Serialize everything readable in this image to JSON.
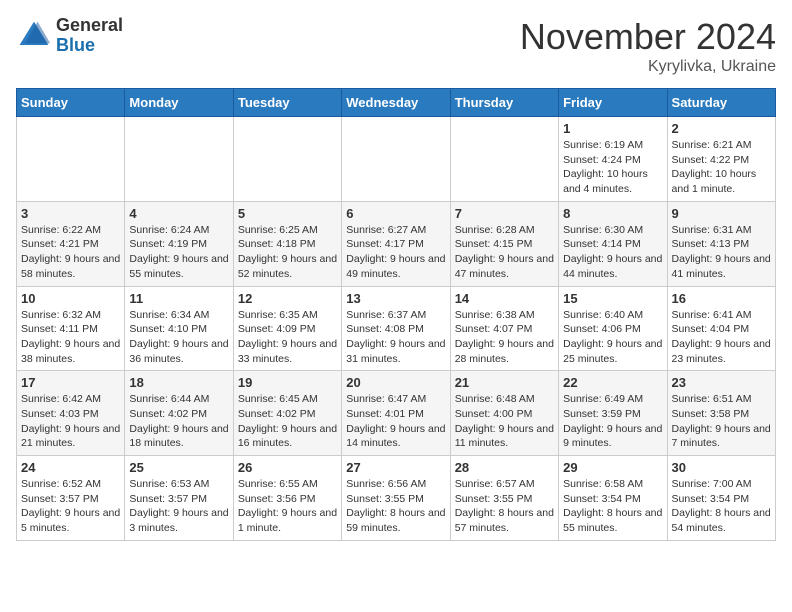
{
  "header": {
    "logo_general": "General",
    "logo_blue": "Blue",
    "month_title": "November 2024",
    "location": "Kyrylivka, Ukraine"
  },
  "weekdays": [
    "Sunday",
    "Monday",
    "Tuesday",
    "Wednesday",
    "Thursday",
    "Friday",
    "Saturday"
  ],
  "weeks": [
    [
      {
        "day": "",
        "info": ""
      },
      {
        "day": "",
        "info": ""
      },
      {
        "day": "",
        "info": ""
      },
      {
        "day": "",
        "info": ""
      },
      {
        "day": "",
        "info": ""
      },
      {
        "day": "1",
        "info": "Sunrise: 6:19 AM\nSunset: 4:24 PM\nDaylight: 10 hours\nand 4 minutes."
      },
      {
        "day": "2",
        "info": "Sunrise: 6:21 AM\nSunset: 4:22 PM\nDaylight: 10 hours\nand 1 minute."
      }
    ],
    [
      {
        "day": "3",
        "info": "Sunrise: 6:22 AM\nSunset: 4:21 PM\nDaylight: 9 hours\nand 58 minutes."
      },
      {
        "day": "4",
        "info": "Sunrise: 6:24 AM\nSunset: 4:19 PM\nDaylight: 9 hours\nand 55 minutes."
      },
      {
        "day": "5",
        "info": "Sunrise: 6:25 AM\nSunset: 4:18 PM\nDaylight: 9 hours\nand 52 minutes."
      },
      {
        "day": "6",
        "info": "Sunrise: 6:27 AM\nSunset: 4:17 PM\nDaylight: 9 hours\nand 49 minutes."
      },
      {
        "day": "7",
        "info": "Sunrise: 6:28 AM\nSunset: 4:15 PM\nDaylight: 9 hours\nand 47 minutes."
      },
      {
        "day": "8",
        "info": "Sunrise: 6:30 AM\nSunset: 4:14 PM\nDaylight: 9 hours\nand 44 minutes."
      },
      {
        "day": "9",
        "info": "Sunrise: 6:31 AM\nSunset: 4:13 PM\nDaylight: 9 hours\nand 41 minutes."
      }
    ],
    [
      {
        "day": "10",
        "info": "Sunrise: 6:32 AM\nSunset: 4:11 PM\nDaylight: 9 hours\nand 38 minutes."
      },
      {
        "day": "11",
        "info": "Sunrise: 6:34 AM\nSunset: 4:10 PM\nDaylight: 9 hours\nand 36 minutes."
      },
      {
        "day": "12",
        "info": "Sunrise: 6:35 AM\nSunset: 4:09 PM\nDaylight: 9 hours\nand 33 minutes."
      },
      {
        "day": "13",
        "info": "Sunrise: 6:37 AM\nSunset: 4:08 PM\nDaylight: 9 hours\nand 31 minutes."
      },
      {
        "day": "14",
        "info": "Sunrise: 6:38 AM\nSunset: 4:07 PM\nDaylight: 9 hours\nand 28 minutes."
      },
      {
        "day": "15",
        "info": "Sunrise: 6:40 AM\nSunset: 4:06 PM\nDaylight: 9 hours\nand 25 minutes."
      },
      {
        "day": "16",
        "info": "Sunrise: 6:41 AM\nSunset: 4:04 PM\nDaylight: 9 hours\nand 23 minutes."
      }
    ],
    [
      {
        "day": "17",
        "info": "Sunrise: 6:42 AM\nSunset: 4:03 PM\nDaylight: 9 hours\nand 21 minutes."
      },
      {
        "day": "18",
        "info": "Sunrise: 6:44 AM\nSunset: 4:02 PM\nDaylight: 9 hours\nand 18 minutes."
      },
      {
        "day": "19",
        "info": "Sunrise: 6:45 AM\nSunset: 4:02 PM\nDaylight: 9 hours\nand 16 minutes."
      },
      {
        "day": "20",
        "info": "Sunrise: 6:47 AM\nSunset: 4:01 PM\nDaylight: 9 hours\nand 14 minutes."
      },
      {
        "day": "21",
        "info": "Sunrise: 6:48 AM\nSunset: 4:00 PM\nDaylight: 9 hours\nand 11 minutes."
      },
      {
        "day": "22",
        "info": "Sunrise: 6:49 AM\nSunset: 3:59 PM\nDaylight: 9 hours\nand 9 minutes."
      },
      {
        "day": "23",
        "info": "Sunrise: 6:51 AM\nSunset: 3:58 PM\nDaylight: 9 hours\nand 7 minutes."
      }
    ],
    [
      {
        "day": "24",
        "info": "Sunrise: 6:52 AM\nSunset: 3:57 PM\nDaylight: 9 hours\nand 5 minutes."
      },
      {
        "day": "25",
        "info": "Sunrise: 6:53 AM\nSunset: 3:57 PM\nDaylight: 9 hours\nand 3 minutes."
      },
      {
        "day": "26",
        "info": "Sunrise: 6:55 AM\nSunset: 3:56 PM\nDaylight: 9 hours\nand 1 minute."
      },
      {
        "day": "27",
        "info": "Sunrise: 6:56 AM\nSunset: 3:55 PM\nDaylight: 8 hours\nand 59 minutes."
      },
      {
        "day": "28",
        "info": "Sunrise: 6:57 AM\nSunset: 3:55 PM\nDaylight: 8 hours\nand 57 minutes."
      },
      {
        "day": "29",
        "info": "Sunrise: 6:58 AM\nSunset: 3:54 PM\nDaylight: 8 hours\nand 55 minutes."
      },
      {
        "day": "30",
        "info": "Sunrise: 7:00 AM\nSunset: 3:54 PM\nDaylight: 8 hours\nand 54 minutes."
      }
    ]
  ]
}
